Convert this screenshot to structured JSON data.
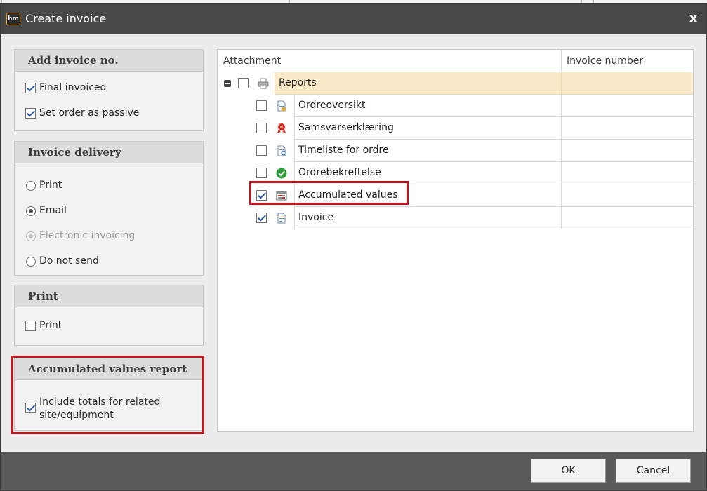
{
  "window": {
    "app_icon_text": "hm",
    "title": "Create invoice",
    "close_glyph": "x"
  },
  "add_invoice_no": {
    "header": "Add invoice no.",
    "options": [
      {
        "label": "Final invoiced",
        "checked": true
      },
      {
        "label": "Set order as passive",
        "checked": true
      }
    ]
  },
  "invoice_delivery": {
    "header": "Invoice delivery",
    "options": [
      {
        "label": "Print",
        "selected": false,
        "disabled": false
      },
      {
        "label": "Email",
        "selected": true,
        "disabled": false
      },
      {
        "label": "Electronic invoicing",
        "selected": false,
        "disabled": true
      },
      {
        "label": "Do not send",
        "selected": false,
        "disabled": false
      }
    ]
  },
  "print_group": {
    "header": "Print",
    "option": {
      "label": "Print",
      "checked": false
    }
  },
  "accumulated_group": {
    "header": "Accumulated values report",
    "option": {
      "label_line1": "Include totals for related",
      "label_line2": "site/equipment",
      "checked": true
    }
  },
  "attachments": {
    "col_attachment": "Attachment",
    "col_invoice_number": "Invoice number",
    "group": {
      "label": "Reports",
      "checked": false,
      "icon": "printer-icon"
    },
    "items": [
      {
        "label": "Ordreoversikt",
        "checked": false,
        "icon": "report-doc-icon",
        "invoice_number": ""
      },
      {
        "label": "Samsvarserklæring",
        "checked": false,
        "icon": "ribbon-award-icon",
        "invoice_number": ""
      },
      {
        "label": "Timeliste for ordre",
        "checked": false,
        "icon": "timesheet-doc-icon",
        "invoice_number": ""
      },
      {
        "label": "Ordrebekreftelse",
        "checked": false,
        "icon": "green-check-icon",
        "invoice_number": ""
      },
      {
        "label": "Accumulated values",
        "checked": true,
        "icon": "table-report-icon",
        "invoice_number": ""
      },
      {
        "label": "Invoice",
        "checked": true,
        "icon": "invoice-doc-icon",
        "invoice_number": ""
      }
    ]
  },
  "buttons": {
    "ok": "OK",
    "cancel": "Cancel"
  },
  "colors": {
    "titlebar": "#474747",
    "highlight_box": "#c0161d",
    "group_row": "#fbeac9",
    "footer": "#5a5a5a"
  }
}
